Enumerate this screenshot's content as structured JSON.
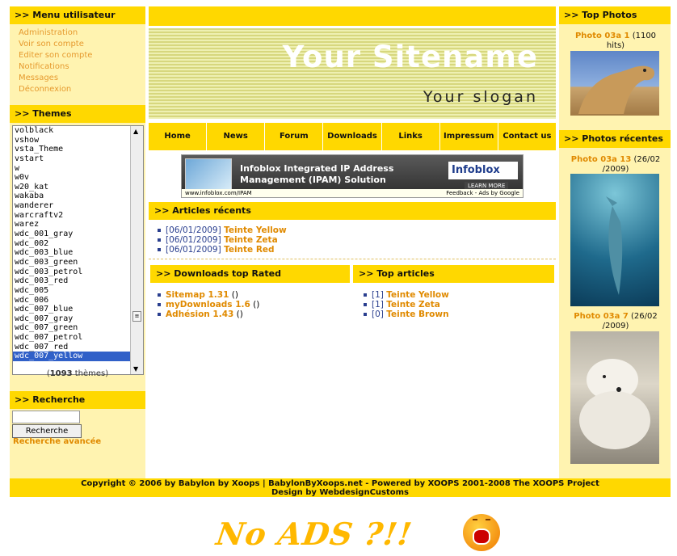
{
  "menu": {
    "title": ">> Menu utilisateur",
    "items": [
      "Administration",
      "Voir son compte",
      "Editer son compte",
      "Notifications",
      "Messages",
      "Déconnexion"
    ]
  },
  "themes": {
    "title": ">> Themes",
    "items": [
      "volblack",
      "vshow",
      "vsta_Theme",
      "vstart",
      "w",
      "w0v",
      "w20_kat",
      "wakaba",
      "wanderer",
      "warcraftv2",
      "warez",
      "wdc_001_gray",
      "wdc_002",
      "wdc_003_blue",
      "wdc_003_green",
      "wdc_003_petrol",
      "wdc_003_red",
      "wdc_005",
      "wdc_006",
      "wdc_007_blue",
      "wdc_007_gray",
      "wdc_007_green",
      "wdc_007_petrol",
      "wdc_007_red",
      "wdc_007_yellow"
    ],
    "selected": "wdc_007_yellow",
    "count_pre": "(",
    "count": "1093",
    "count_post": " thèmes)"
  },
  "search": {
    "title": ">> Recherche",
    "button": "Recherche",
    "advanced": "Recherche avancée"
  },
  "header": {
    "site_name": "Your Sitename",
    "slogan": "Your slogan"
  },
  "nav": [
    "Home",
    "News",
    "Forum",
    "Downloads",
    "Links",
    "Impressum",
    "Contact us"
  ],
  "ad": {
    "headline_1": "Infoblox Integrated IP Address",
    "headline_2": "Management (IPAM) Solution",
    "brand": "Infoblox",
    "learn": "LEARN MORE",
    "url": "www.infoblox.com/IPAM",
    "feedback": "Feedback - Ads by Google"
  },
  "recent_articles": {
    "title": ">> Articles récents",
    "items": [
      {
        "date": "[06/01/2009]",
        "name": "Teinte Yellow"
      },
      {
        "date": "[06/01/2009]",
        "name": "Teinte Zeta"
      },
      {
        "date": "[06/01/2009]",
        "name": "Teinte Red"
      }
    ]
  },
  "downloads": {
    "title": ">> Downloads top Rated",
    "items": [
      {
        "name": "Sitemap 1.31",
        "extra": " ()"
      },
      {
        "name": "myDownloads 1.6",
        "extra": " ()"
      },
      {
        "name": "Adhésion 1.43",
        "extra": " ()"
      }
    ]
  },
  "top_articles": {
    "title": ">> Top articles",
    "items": [
      {
        "count": "[1]",
        "name": "Teinte Yellow"
      },
      {
        "count": "[1]",
        "name": "Teinte Zeta"
      },
      {
        "count": "[0]",
        "name": "Teinte Brown"
      }
    ]
  },
  "top_photos": {
    "title": ">> Top Photos",
    "photo": {
      "name": "Photo 03a 1",
      "info": " (1100 hits)",
      "subject": "camel"
    }
  },
  "recent_photos": {
    "title": ">> Photos récentes",
    "photos": [
      {
        "name": "Photo 03a 13",
        "info": " (26/02 /2009)",
        "subject": "dolphin"
      },
      {
        "name": "Photo 03a 7",
        "info": " (26/02 /2009)",
        "subject": "polar-bear"
      }
    ]
  },
  "footer": {
    "line1": "Copyright © 2006 by Babylon by Xoops  |  BabylonByXoops.net - Powered by XOOPS 2001-2008 The XOOPS Project",
    "line2": "Design by WebdesignCustoms"
  },
  "promo": {
    "text": "No ADS ?!!"
  },
  "colors": {
    "accent": "#ffd800",
    "panel": "#fff3b0",
    "link": "#e08a00",
    "nav_blue": "#2a3f8f"
  }
}
